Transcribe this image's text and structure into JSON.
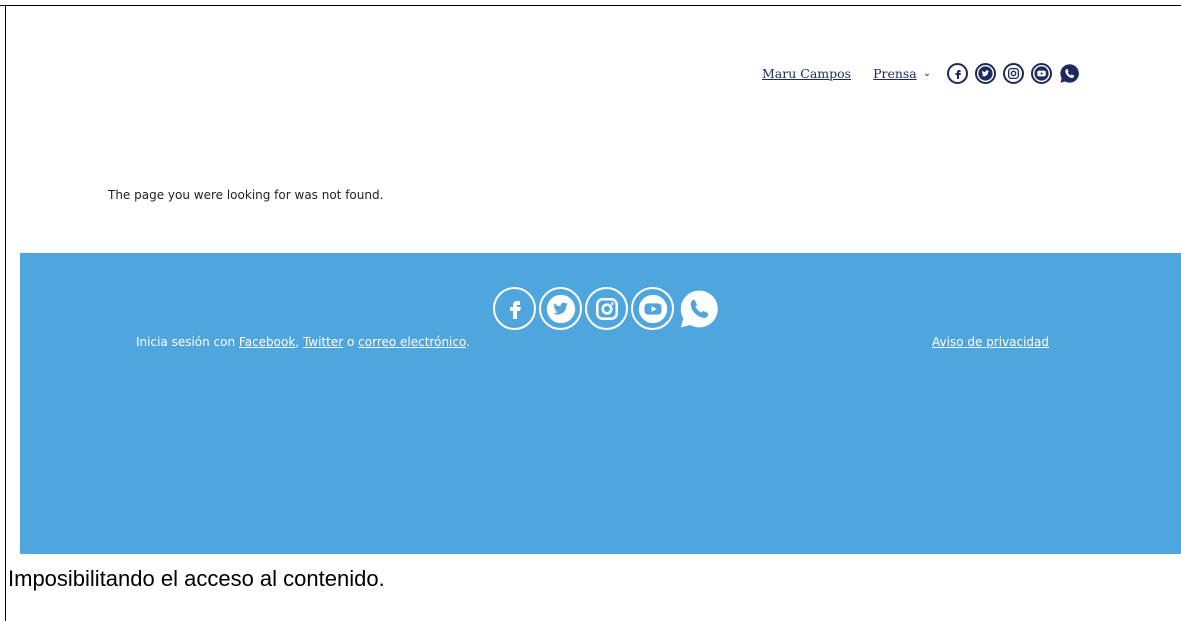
{
  "header": {
    "nav_link_1": "Maru Campos",
    "nav_link_2": "Prensa",
    "social_icons": [
      "facebook-icon",
      "twitter-icon",
      "instagram-icon",
      "youtube-icon",
      "whatsapp-icon"
    ]
  },
  "main": {
    "message": "The page you were looking for was not found."
  },
  "footer": {
    "login_prefix": "Inicia sesión con ",
    "facebook_link": "Facebook",
    "comma": ", ",
    "twitter_link": "Twitter",
    "or": " o ",
    "email_link": "correo electrónico",
    "period": ".",
    "privacy_link": "Aviso de privacidad",
    "social_icons": [
      "facebook-icon",
      "twitter-icon",
      "instagram-icon",
      "youtube-icon",
      "whatsapp-icon"
    ]
  },
  "caption": "Imposibilitando el acceso al contenido.",
  "colors": {
    "footer_bg": "#4ea6dd",
    "nav_text": "#1e2a5e"
  }
}
